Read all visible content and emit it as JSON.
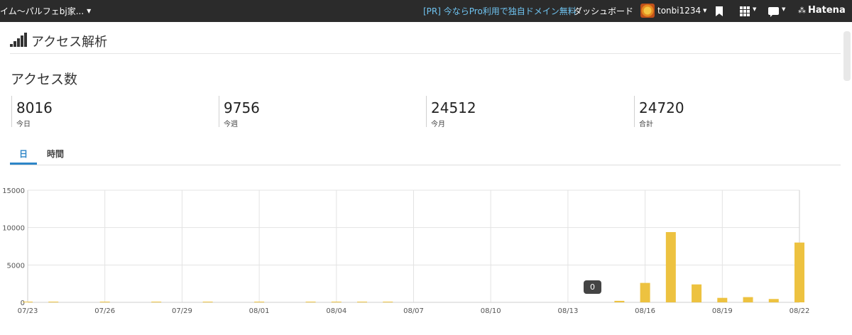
{
  "topbar": {
    "blog_name": "イム〜パルフェbj家...",
    "pr_link": "[PR] 今ならPro利用で独自ドメイン無料",
    "dashboard": "ダッシュボード",
    "username": "tonbi1234",
    "brand": "Hatena"
  },
  "page": {
    "title": "アクセス解析",
    "section_title": "アクセス数"
  },
  "stats": [
    {
      "value": "8016",
      "label": "今日"
    },
    {
      "value": "9756",
      "label": "今週"
    },
    {
      "value": "24512",
      "label": "今月"
    },
    {
      "value": "24720",
      "label": "合計"
    }
  ],
  "tabs": [
    {
      "label": "日",
      "active": true
    },
    {
      "label": "時間",
      "active": false
    }
  ],
  "chart_data": {
    "type": "bar",
    "ylim": [
      0,
      15000
    ],
    "y_ticks": [
      "15000",
      "10000",
      "5000",
      "0"
    ],
    "x_tick_labels": [
      "07/23",
      "07/26",
      "07/29",
      "08/01",
      "08/04",
      "08/07",
      "08/10",
      "08/13",
      "08/16",
      "08/19",
      "08/22"
    ],
    "categories": [
      "07/23",
      "07/24",
      "07/25",
      "07/26",
      "07/27",
      "07/28",
      "07/29",
      "07/30",
      "07/31",
      "08/01",
      "08/02",
      "08/03",
      "08/04",
      "08/05",
      "08/06",
      "08/07",
      "08/08",
      "08/09",
      "08/10",
      "08/11",
      "08/12",
      "08/13",
      "08/14",
      "08/15",
      "08/16",
      "08/17",
      "08/18",
      "08/19",
      "08/20",
      "08/21",
      "08/22"
    ],
    "values": [
      10,
      5,
      0,
      5,
      0,
      10,
      0,
      5,
      0,
      5,
      0,
      10,
      5,
      5,
      10,
      0,
      0,
      0,
      0,
      0,
      0,
      0,
      0,
      200,
      2600,
      9400,
      2400,
      600,
      700,
      450,
      8000
    ],
    "bar_color": "#edc240",
    "tooltip": "0",
    "grid": true
  }
}
